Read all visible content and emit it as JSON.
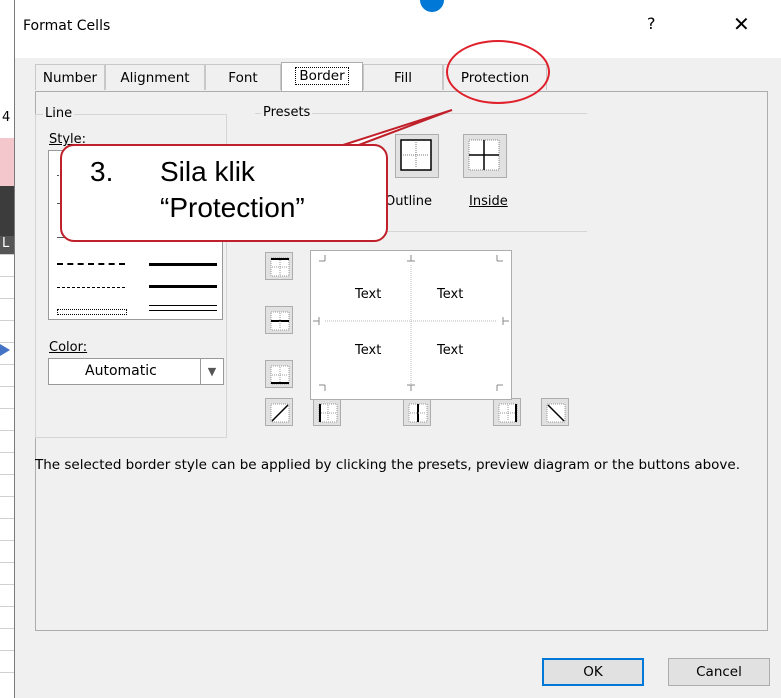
{
  "window": {
    "title": "Format Cells",
    "help_label": "?",
    "close_label": "✕"
  },
  "tabs": [
    {
      "label": "Number"
    },
    {
      "label": "Alignment"
    },
    {
      "label": "Font"
    },
    {
      "label": "Border",
      "selected": true
    },
    {
      "label": "Fill"
    },
    {
      "label": "Protection"
    }
  ],
  "line_group": {
    "label": "Line",
    "style_label": "Style:",
    "color_label": "Color:",
    "color_value": "Automatic"
  },
  "presets_group": {
    "label": "Presets",
    "outline_label": "Outline",
    "inside_label": "Inside"
  },
  "preview": {
    "cells": [
      "Text",
      "Text",
      "Text",
      "Text"
    ]
  },
  "description": "The selected border style can be applied by clicking the presets, preview diagram or the buttons above.",
  "buttons": {
    "ok": "OK",
    "cancel": "Cancel"
  },
  "callout": {
    "number": "3.",
    "line1": "Sila klik",
    "line2": "“Protection”"
  },
  "colors": {
    "callout_border": "#c0202a",
    "ok_border": "#0078d7"
  },
  "background": {
    "visible_text": [
      "4",
      "L"
    ]
  }
}
